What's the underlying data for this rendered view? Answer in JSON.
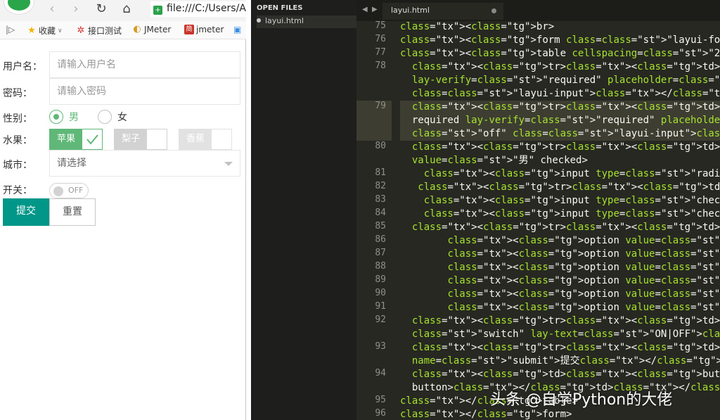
{
  "browser": {
    "address": "file:///C:/Users/A",
    "bookmarks": [
      "收藏",
      "接口测试",
      "JMeter",
      "jmeter"
    ],
    "form": {
      "username_label": "用户名：",
      "username_placeholder": "请输入用户名",
      "password_label": "密码：",
      "password_placeholder": "请输入密码",
      "gender_label": "性别：",
      "gender_male": "男",
      "gender_female": "女",
      "fruit_label": "水果：",
      "fruit_apple": "苹果",
      "fruit_pear": "梨子",
      "fruit_banana": "香蕉",
      "city_label": "城市：",
      "city_placeholder": "请选择",
      "switch_label": "开关：",
      "switch_text": "OFF",
      "submit_label": "提交",
      "reset_label": "重置"
    }
  },
  "editor": {
    "sidebar_header": "OPEN FILES",
    "open_file": "layui.html",
    "tab_title": "layui.html",
    "line_numbers": [
      "75",
      "76",
      "77",
      "78",
      "79",
      "80",
      "81",
      "82",
      "83",
      "84",
      "85",
      "86",
      "87",
      "88",
      "89",
      "90",
      "91",
      "92",
      "93",
      "94",
      "95",
      "96"
    ],
    "code_lines": [
      "<br>",
      "<form class=\"layui-form\">",
      "<table cellspacing=\"20px\" cellpadding=\"20px\">",
      "  <tr><td>用户名：</td><td><input type=\"text\" name=",
      "  lay-verify=\"required\" placeholder=\"请输入用户名\"",
      "  class=\"layui-input\"></td></tr>",
      "  <tr><td>密码：</td><td><input type=\"password\" nam",
      "  required lay-verify=\"required\" placeholder=\"请输入",
      "  \"off\" class=\"layui-input\"></td></tr>",
      "  <tr><td>性别：</td><td><input type=\"radio\" name=",
      "  value=\"男\" checked>",
      "    <input type=\"radio\" name=\"sex\" title=\"女\" value",
      "   <tr><td>水果：</td><td><input type=\"checkbox\" ti",
      "    <input type=\"checkbox\" title=\"梨子\" >",
      "    <input type=\"checkbox\" title=\"香蕉\" disabled></",
      "  <tr><td>城市：</td><td><select name=\"city\" lay-ve",
      "        <option value=\"\"></option>",
      "        <option value=\"0\">0</option>",
      "        <option value=\"1\">1</option>",
      "        <option value=\"2\">2</option>",
      "        <option value=\"3\">3</option>",
      "        <option value=\"4\">4</option></select></td><",
      "  <tr><td>开关：</td><td><input type=\"checkbox\" nam",
      "  \"switch\" lay-text=\"ON|OFF\"></td></tr>",
      "  <tr><td><button class=\"layui-btn\" lay-submit lay-",
      "  name=\"submit\">提交</button></td>",
      "  <td><button type=\"reset\" class=\"layui-btn layui-b",
      "  button></td></tr>",
      "</table>",
      "</form>"
    ]
  },
  "watermark": "头条 @自学Python的大佬",
  "colors": {
    "layui_green": "#5FB878",
    "layui_primary": "#009688",
    "editor_bg": "#272822"
  }
}
